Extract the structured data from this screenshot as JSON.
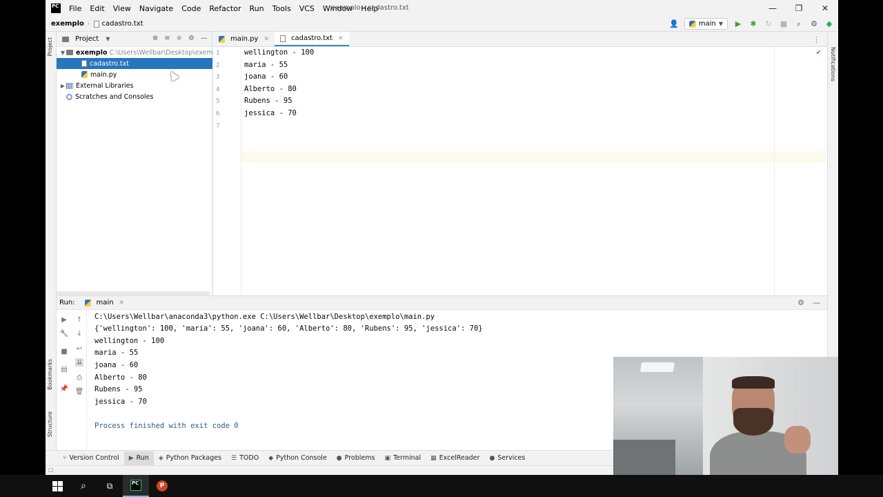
{
  "window": {
    "title": "exemplo - cadastro.txt",
    "menu": [
      "File",
      "Edit",
      "View",
      "Navigate",
      "Code",
      "Refactor",
      "Run",
      "Tools",
      "VCS",
      "Window",
      "Help"
    ],
    "controls": [
      "—",
      "❐",
      "✕"
    ]
  },
  "breadcrumb": {
    "root": "exemplo",
    "file": "cadastro.txt"
  },
  "run_config": {
    "name": "main"
  },
  "project": {
    "title": "Project",
    "root_name": "exemplo",
    "root_path": "C:\\Users\\Wellbar\\Desktop\\exemplo",
    "files": [
      "cadastro.txt",
      "main.py"
    ],
    "external": "External Libraries",
    "scratches": "Scratches and Consoles"
  },
  "editor": {
    "tabs": [
      {
        "label": "main.py",
        "active": false
      },
      {
        "label": "cadastro.txt",
        "active": true
      }
    ],
    "line_numbers": [
      "1",
      "2",
      "3",
      "4",
      "5",
      "6",
      "7"
    ],
    "lines": [
      "wellington - 100",
      "maria - 55",
      "joana - 60",
      "Alberto - 80",
      "Rubens - 95",
      "jessica - 70",
      ""
    ]
  },
  "side_labels": {
    "project": "Project",
    "bookmarks": "Bookmarks",
    "structure": "Structure",
    "notifications": "Notifications"
  },
  "run_panel": {
    "label": "Run:",
    "tab": "main",
    "output": [
      "C:\\Users\\Wellbar\\anaconda3\\python.exe C:\\Users\\Wellbar\\Desktop\\exemplo\\main.py",
      "{'wellington': 100, 'maria': 55, 'joana': 60, 'Alberto': 80, 'Rubens': 95, 'jessica': 70}",
      "wellington - 100",
      "maria - 55",
      "joana - 60",
      "Alberto - 80",
      "Rubens - 95",
      "jessica - 70",
      "",
      "Process finished with exit code 0"
    ]
  },
  "tool_windows": [
    "Version Control",
    "Run",
    "Python Packages",
    "TODO",
    "Python Console",
    "Problems",
    "Terminal",
    "ExcelReader",
    "Services"
  ],
  "taskbar": {
    "pycharm_label": "PC",
    "ppt_label": "P"
  }
}
